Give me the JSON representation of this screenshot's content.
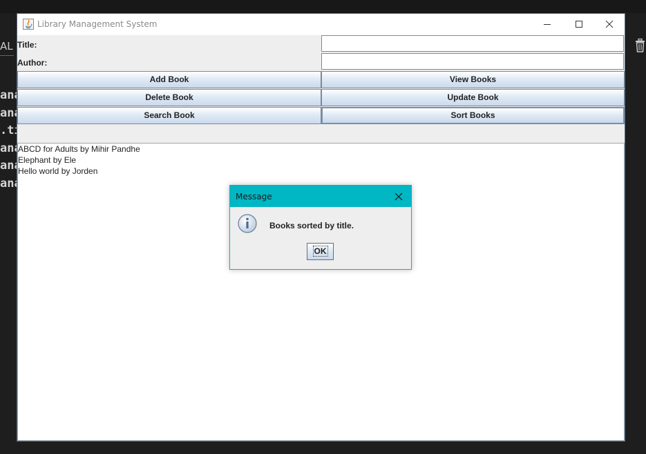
{
  "background": {
    "panel_label": "AL",
    "code_lines": [
      "ana",
      "ana",
      ".ti",
      "ana",
      "ana",
      "ana"
    ]
  },
  "window": {
    "title": "Library Management System",
    "title_label": "Title:",
    "author_label": "Author:",
    "title_value": "",
    "author_value": "",
    "buttons": {
      "add": "Add Book",
      "view": "View Books",
      "delete": "Delete Book",
      "update": "Update Book",
      "search": "Search Book",
      "sort": "Sort Books"
    },
    "books": [
      "ABCD for Adults by Mihir Pandhe",
      "Elephant by Ele",
      "Hello world by Jorden"
    ]
  },
  "dialog": {
    "title": "Message",
    "message": "Books sorted by title.",
    "ok_label": "OK",
    "icon": "info-icon"
  },
  "colors": {
    "dialog_titlebar": "#00b7c3",
    "button_gradient_top": "#ffffff",
    "button_gradient_bottom": "#c9d9ec"
  }
}
